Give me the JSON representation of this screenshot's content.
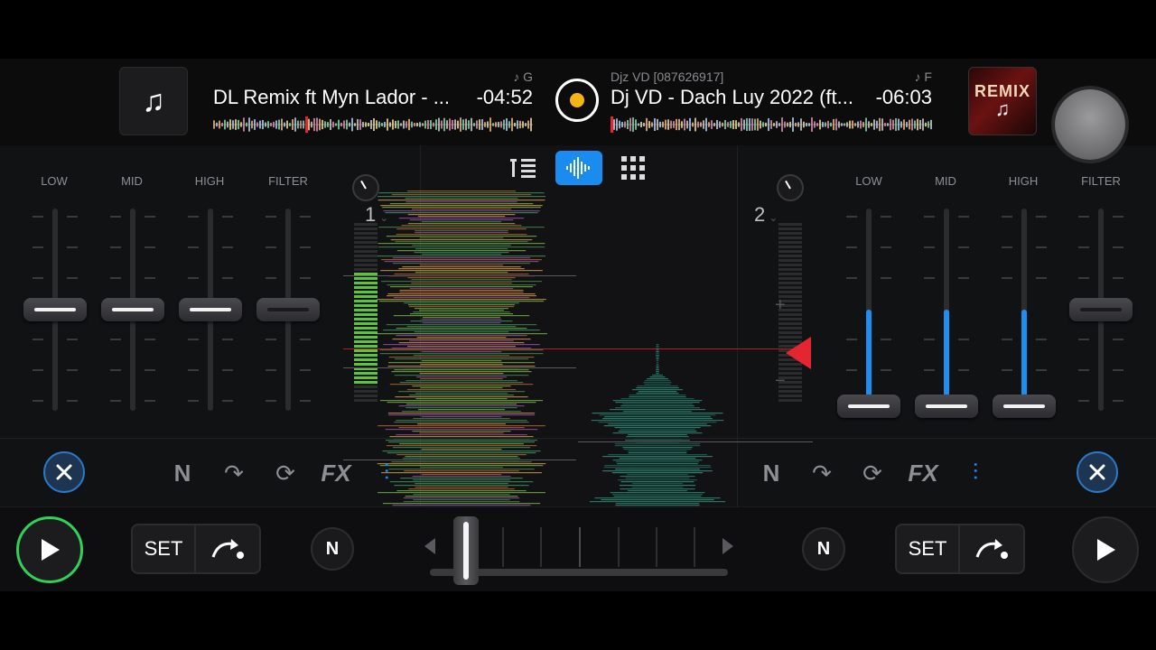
{
  "deck_left": {
    "artist": "",
    "key": "♪ G",
    "title": "DL Remix ft Myn Lador - ...",
    "time": "-04:52",
    "deck_number": "1",
    "eq_labels": [
      "LOW",
      "MID",
      "HIGH",
      "FILTER"
    ]
  },
  "deck_right": {
    "artist": "Djz VD [087626917]",
    "key": "♪ F",
    "title": "Dj VD - Dach Luy 2022 (ft...",
    "time": "-06:03",
    "deck_number": "2",
    "eq_labels": [
      "LOW",
      "MID",
      "HIGH",
      "FILTER"
    ],
    "art_text": "REMIX"
  },
  "controls": {
    "fx_label": "FX",
    "set_label": "SET",
    "neural_label": "N"
  },
  "colors": {
    "accent": "#1a8cf0",
    "play_active": "#30d158",
    "center_dot": "#f5b50f",
    "marker": "#e3262f"
  },
  "icons": {
    "left_art": "music-note-icon",
    "center": "record-icon",
    "view_modes": [
      "list-bars-icon",
      "waveform-icon",
      "grid-icon"
    ]
  }
}
